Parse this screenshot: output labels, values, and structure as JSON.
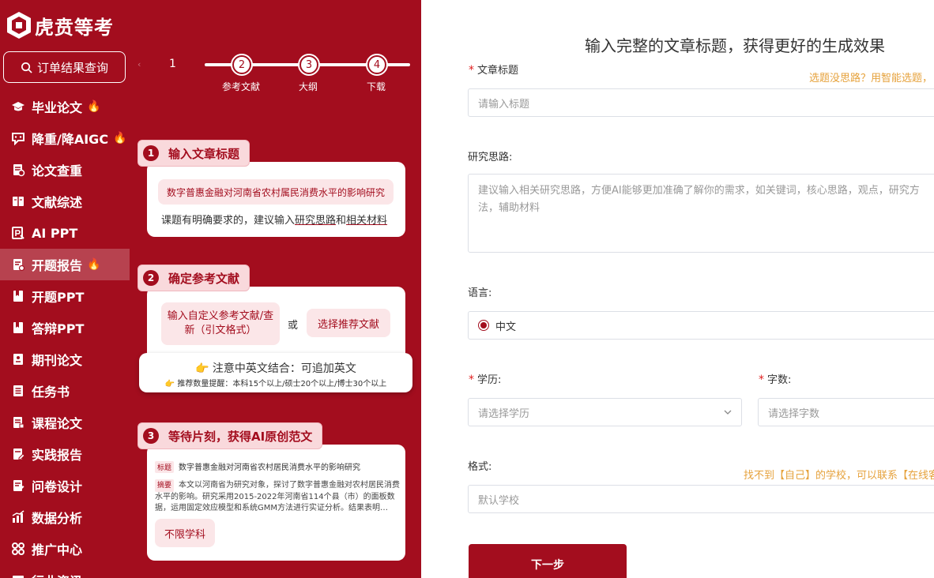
{
  "brand": {
    "name": "虎贲等考"
  },
  "sidebar": {
    "order_query": "订单结果查询",
    "items": [
      {
        "label": "毕业论文",
        "icon": "graduation-cap-icon",
        "hot": true
      },
      {
        "label": "降重/降AIGC",
        "icon": "chat-icon",
        "hot": true
      },
      {
        "label": "论文查重",
        "icon": "document-check-icon",
        "hot": false
      },
      {
        "label": "文献综述",
        "icon": "book-icon",
        "hot": false
      },
      {
        "label": "AI PPT",
        "icon": "ppt-icon",
        "hot": false
      },
      {
        "label": "开题报告",
        "icon": "report-icon",
        "hot": true,
        "active": true
      },
      {
        "label": "开题PPT",
        "icon": "bookmark-icon",
        "hot": false
      },
      {
        "label": "答辩PPT",
        "icon": "bookmark-icon",
        "hot": false
      },
      {
        "label": "期刊论文",
        "icon": "journal-icon",
        "hot": false
      },
      {
        "label": "任务书",
        "icon": "list-icon",
        "hot": false
      },
      {
        "label": "课程论文",
        "icon": "document-icon",
        "hot": false
      },
      {
        "label": "实践报告",
        "icon": "edit-doc-icon",
        "hot": false
      },
      {
        "label": "问卷设计",
        "icon": "survey-icon",
        "hot": false
      },
      {
        "label": "数据分析",
        "icon": "chart-icon",
        "hot": false
      },
      {
        "label": "推广中心",
        "icon": "grid-icon",
        "hot": false
      },
      {
        "label": "行业资讯",
        "icon": "news-icon",
        "hot": false
      }
    ]
  },
  "steps": {
    "current": "1",
    "items": [
      {
        "num": "2",
        "label": "参考文献"
      },
      {
        "num": "3",
        "label": "大纲"
      },
      {
        "num": "4",
        "label": "下载"
      }
    ]
  },
  "promo": {
    "card1": {
      "num": "1",
      "title": "输入文章标题",
      "example": "数字普惠金融对河南省农村属民消费水平的影响研究",
      "note_prefix": "课题有明确要求的，建议输入",
      "note_link1": "研究思路",
      "note_and": "和",
      "note_link2": "相关材料"
    },
    "card2": {
      "num": "2",
      "title": "确定参考文献",
      "left": "输入自定义参考文献/查新（引文格式）",
      "or": "或",
      "right": "选择推荐文献",
      "tip_title": "👉 注意中英文结合：可追加英文",
      "tip_sub": "👉 推荐数量提醒：本科15个以上/硕士20个以上/博士30个以上"
    },
    "card3": {
      "num": "3",
      "title": "等待片刻，获得AI原创范文",
      "title_tag": "标题",
      "paper_title": "数字普惠金融对河南省农村居民消费水平的影响研究",
      "abstract_tag": "摘要",
      "abstract": "本文以河南省为研究对象，探讨了数字普惠金融对农村居民消费水平的影响。研究采用2015-2022年河南省114个县（市）的面板数据，运用固定效应模型和系统GMM方法进行实证分析。结果表明…",
      "subject": "不限学科"
    }
  },
  "form": {
    "heading": "输入完整的文章标题，获得更好的生成效果",
    "title_label": "文章标题",
    "title_hint": "选题没思路？用智能选题，",
    "title_placeholder": "请输入标题",
    "idea_label": "研究思路:",
    "idea_placeholder": "建议输入相关研究思路，方便AI能够更加准确了解你的需求，如关键词，核心思路，观点，研究方法，辅助材料",
    "lang_label": "语言:",
    "lang_value": "中文",
    "edu_label": "学历:",
    "edu_placeholder": "请选择学历",
    "words_label": "字数:",
    "words_placeholder": "请选择字数",
    "format_label": "格式:",
    "format_hint": "找不到【自己】的学校，可以联系【在线客服】",
    "format_placeholder": "默认学校",
    "next": "下一步"
  },
  "colors": {
    "brand": "#a30d1e",
    "hint": "#e6a23c"
  }
}
